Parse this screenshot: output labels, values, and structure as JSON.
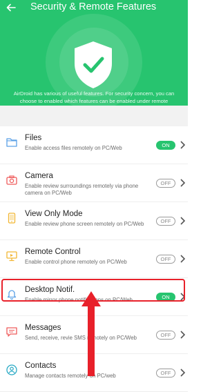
{
  "header": {
    "title": "Security & Remote Features",
    "description": "AirDroid has various of useful features. For security concern, you can choose to enabled which features can be enabled under remote connection",
    "back_icon": "arrow-left-icon",
    "shield_icon": "shield-check-icon"
  },
  "colors": {
    "brand": "#27c46f",
    "highlight": "#e8202a",
    "icon_files": "#5aa0e6",
    "icon_camera": "#ef5b5b",
    "icon_view": "#f2b632",
    "icon_remote": "#f2b632",
    "icon_notif": "#5aa0e6",
    "icon_messages": "#ef5b5b",
    "icon_contacts": "#27a9c4"
  },
  "features": [
    {
      "title": "Files",
      "subtitle": "Enable access files remotely on PC/Web",
      "toggle": "ON",
      "icon": "folder-icon"
    },
    {
      "title": "Camera",
      "subtitle": "Enable review surroundings remotely via phone camera on PC/Web",
      "toggle": "OFF",
      "icon": "camera-icon"
    },
    {
      "title": "View Only Mode",
      "subtitle": "Enable review phone screen remotely on PC/Web",
      "toggle": "OFF",
      "icon": "phone-icon"
    },
    {
      "title": "Remote Control",
      "subtitle": "Enable control phone remotely on PC/Web",
      "toggle": "OFF",
      "icon": "monitor-icon"
    },
    {
      "title": "Desktop Notif.",
      "subtitle": "Enable mirror phone notifications on PC/Web",
      "toggle": "ON",
      "icon": "bell-icon"
    },
    {
      "title": "Messages",
      "subtitle": "Send, receive, revie SMS remotely on PC/Web",
      "toggle": "OFF",
      "icon": "message-icon"
    },
    {
      "title": "Contacts",
      "subtitle": "Manage contacts remotely on PC/web",
      "toggle": "OFF",
      "icon": "contact-icon"
    }
  ]
}
